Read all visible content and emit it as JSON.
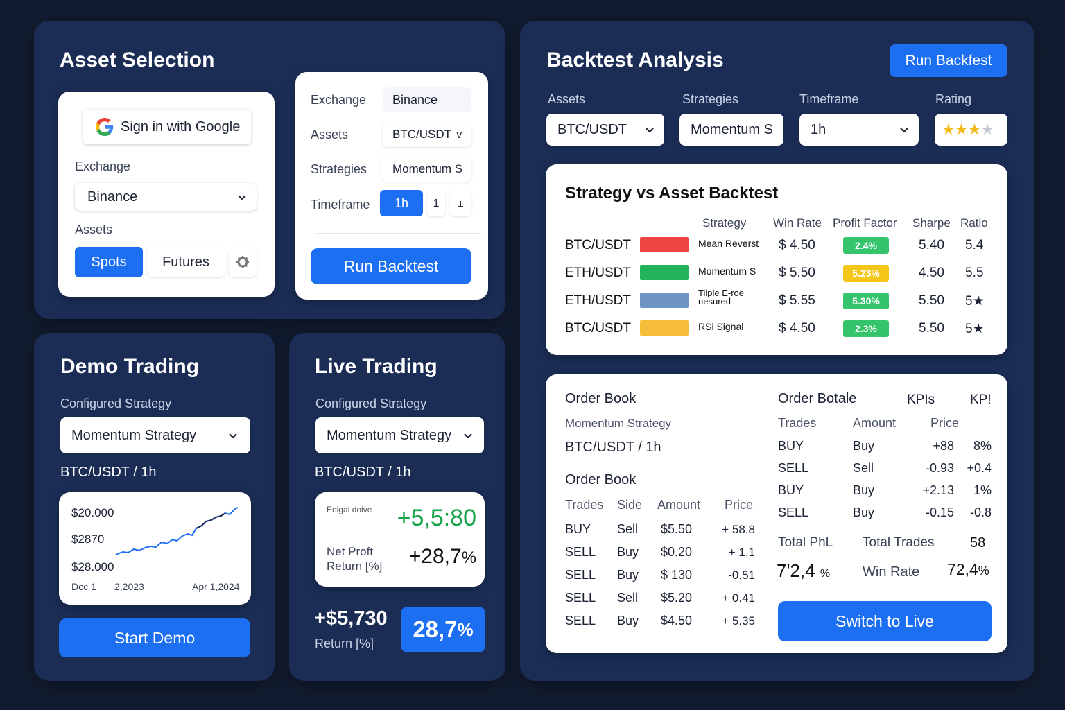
{
  "asset_selection": {
    "title": "Asset Selection",
    "google_signin": "Sign in with Google",
    "exchange_label": "Exchange",
    "exchange_value": "Binance",
    "assets_label": "Assets",
    "spots_label": "Spots",
    "futures_label": "Futures",
    "right_card": {
      "exchange_label": "Exchange",
      "exchange_value": "Binance",
      "assets_label": "Assets",
      "assets_value": "BTC/USDT",
      "assets_chevron": "v",
      "strategies_label": "Strategies",
      "strategies_value": "Momentum S",
      "timeframe_label": "Timeframe",
      "timeframe_value": "1h",
      "timeframe_step": "1",
      "run_backtest": "Run Backtest"
    }
  },
  "demo_trading": {
    "title": "Demo Trading",
    "configured_label": "Configured Strategy",
    "strategy_value": "Momentum Strategy",
    "pair": "BTC/USDT / 1h",
    "chart": {
      "y_labels": [
        "$20.000",
        "$2870",
        "$28.000"
      ],
      "x_labels": [
        "Dcc 1",
        "2,2023",
        "Apr 1,2024"
      ],
      "line_color": "#1d6ff2"
    },
    "start_demo": "Start Demo"
  },
  "live_trading": {
    "title": "Live Trading",
    "configured_label": "Configured Strategy",
    "strategy_value": "Momentum Strategy",
    "pair": "BTC/USDT / 1h",
    "small_label": "Eoiɡal doive",
    "big_value": "+5,5:80",
    "net_profit_label": "Net Proft",
    "return_label": "Return [%]",
    "net_profit_value": "+28,7",
    "net_profit_unit": "%",
    "total_value": "+$5,730",
    "total_return_label": "Return [%]",
    "return_badge": "28,7",
    "return_badge_unit": "%"
  },
  "backtest": {
    "title": "Backtest Analysis",
    "run_button": "Run Backfest",
    "filters": {
      "assets_label": "Assets",
      "assets_value": "BTC/USDT",
      "strategies_label": "Strategies",
      "strategies_value": "Momentum S",
      "timeframe_label": "Timeframe",
      "timeframe_value": "1h",
      "rating_label": "Rating",
      "rating_stars": 3,
      "rating_max": 4
    },
    "table": {
      "title": "Strategy vs Asset Backtest",
      "headers": [
        "Strategy",
        "Win Rate",
        "Profit Factor",
        "Sharpe",
        "Ratio"
      ],
      "rows": [
        {
          "asset": "BTC/USDT",
          "swatch": "#ef4444",
          "strategy": "Mean Reverst",
          "win_rate": "$ 4.50",
          "profit": "2.4%",
          "profit_color": "#34c46b",
          "sharpe": "5.40",
          "ratio": "5.4"
        },
        {
          "asset": "ETH/USDT",
          "swatch": "#22b45a",
          "strategy": "Momentum S",
          "win_rate": "$ 5.50",
          "profit": "5.23%",
          "profit_color": "#f5c518",
          "sharpe": "4.50",
          "ratio": "5.5"
        },
        {
          "asset": "ETH/USDT",
          "swatch": "#6f95c7",
          "strategy": "Tiiple E-roe nesured",
          "win_rate": "$ 5.55",
          "profit": "5.30%",
          "profit_color": "#34c46b",
          "sharpe": "5.50",
          "ratio": "5★"
        },
        {
          "asset": "BTC/USDT",
          "swatch": "#f6bd3b",
          "strategy": "RSi Signal",
          "win_rate": "$ 4.50",
          "profit": "2.3%",
          "profit_color": "#34c46b",
          "sharpe": "5.50",
          "ratio": "5★"
        }
      ]
    }
  },
  "order_book": {
    "title": "Order Book",
    "strategy": "Momentum Strategy",
    "pair": "BTC/USDT / 1h",
    "subtitle": "Order Book",
    "headers": [
      "Trades",
      "Side",
      "Amount",
      "Price"
    ],
    "rows": [
      {
        "trade": "BUY",
        "side": "Sell",
        "amount": "$5.50",
        "price": "+ 58.8",
        "dir": "up"
      },
      {
        "trade": "SELL",
        "side": "Buy",
        "amount": "$0.20",
        "price": "+ 1.1",
        "dir": "up"
      },
      {
        "trade": "SELL",
        "side": "Buy",
        "amount": "$ 130",
        "price": "-0.51",
        "dir": "down"
      },
      {
        "trade": "SELL",
        "side": "Sell",
        "amount": "$5.20",
        "price": "+ 0.41",
        "dir": "up"
      },
      {
        "trade": "SELL",
        "side": "Buy",
        "amount": "$4.50",
        "price": "+ 5.35",
        "dir": "up"
      }
    ],
    "right": {
      "title": "Order Botale",
      "kpis1": "KPIs",
      "kpis2": "KP!",
      "headers": [
        "Trades",
        "Amount",
        "Price"
      ],
      "rows": [
        {
          "trade": "BUY",
          "amount": "Buy",
          "price": "+88",
          "pct": "8%",
          "dir": "up"
        },
        {
          "trade": "SELL",
          "amount": "Sell",
          "price": "-0.93",
          "pct": "+0.4",
          "dir": "mixed"
        },
        {
          "trade": "BUY",
          "amount": "Buy",
          "price": "+2.13",
          "pct": "1%",
          "dir": "up"
        },
        {
          "trade": "SELL",
          "amount": "Buy",
          "price": "-0.15",
          "pct": "-0.8",
          "dir": "down"
        }
      ],
      "total_pnl_label": "Total PhL",
      "total_trades_label": "Total Trades",
      "total_trades_value": "58",
      "pnl_value": "7'2,4",
      "pnl_unit": "%",
      "win_rate_label": "Win Rate",
      "win_rate_value": "72,4",
      "win_rate_unit": "%",
      "switch_button": "Switch to Live"
    }
  }
}
